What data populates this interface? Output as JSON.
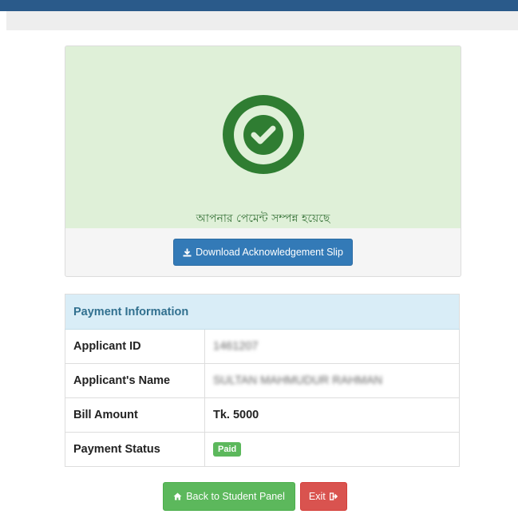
{
  "success": {
    "message": "আপনার পেমেন্ট সম্পন্ন হয়েছে",
    "download_label": "Download Acknowledgement Slip",
    "icon": "check-circle-icon"
  },
  "payment": {
    "header": "Payment Information",
    "rows": [
      {
        "label": "Applicant ID",
        "value": "1461207"
      },
      {
        "label": "Applicant's Name",
        "value": "SULTAN MAHMUDUR RAHMAN"
      },
      {
        "label": "Bill Amount",
        "value": "Tk. 5000"
      },
      {
        "label": "Payment Status",
        "value": "Paid"
      }
    ]
  },
  "actions": {
    "back_label": "Back to Student Panel",
    "exit_label": "Exit"
  },
  "colors": {
    "success_green": "#2f7d32",
    "primary_blue": "#337ab7",
    "paid_badge": "#5cb85c",
    "exit_red": "#d9534f"
  }
}
